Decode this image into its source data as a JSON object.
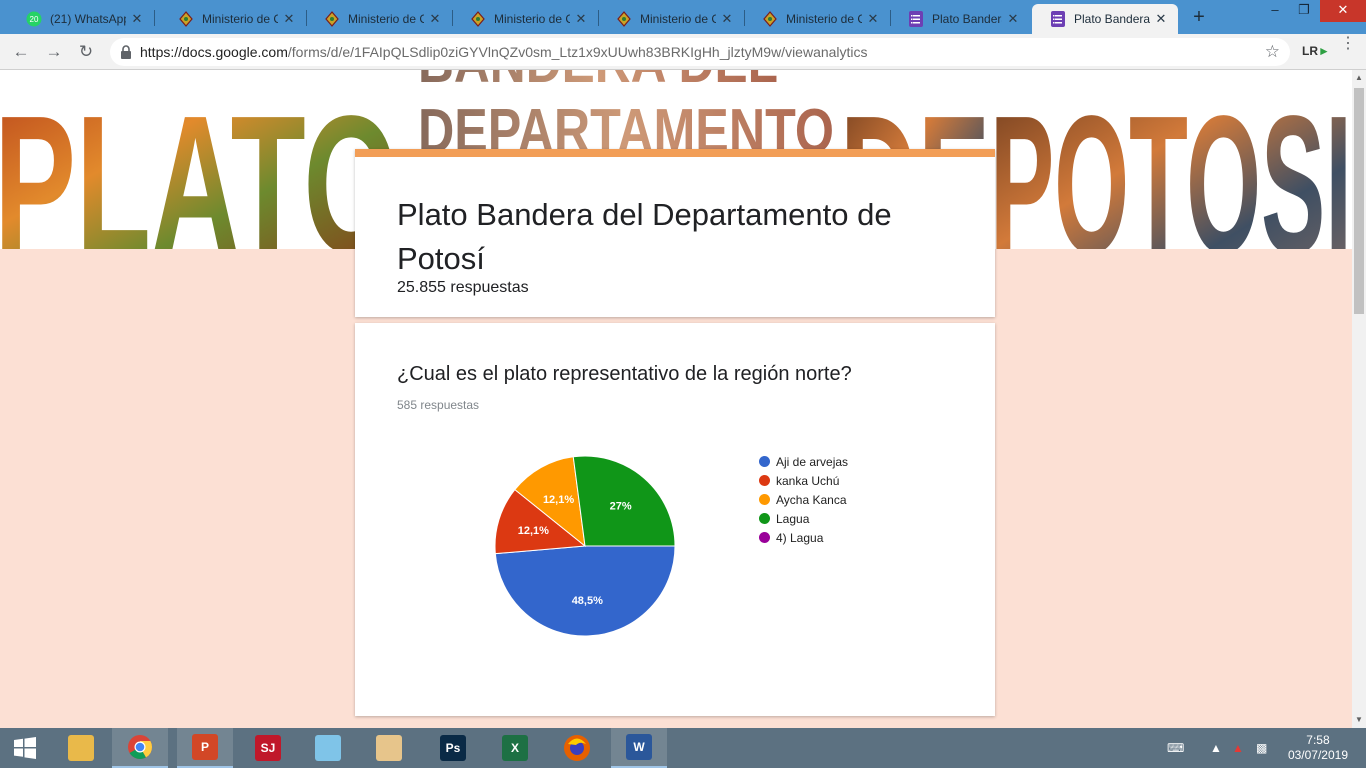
{
  "browser": {
    "tabs": [
      {
        "title": "(21) WhatsApp",
        "icon": "whatsapp-icon",
        "active": false
      },
      {
        "title": "Ministerio de C",
        "icon": "ministerio-icon",
        "active": false
      },
      {
        "title": "Ministerio de C",
        "icon": "ministerio-icon",
        "active": false
      },
      {
        "title": "Ministerio de C",
        "icon": "ministerio-icon",
        "active": false
      },
      {
        "title": "Ministerio de C",
        "icon": "ministerio-icon",
        "active": false
      },
      {
        "title": "Ministerio de C",
        "icon": "ministerio-icon",
        "active": false
      },
      {
        "title": "Plato Bandera d",
        "icon": "google-forms-icon",
        "active": false
      },
      {
        "title": "Plato Bandera d",
        "icon": "google-forms-icon",
        "active": true
      }
    ],
    "whatsapp_badge": "20",
    "url_host": "https://docs.google.com",
    "url_path": "/forms/d/e/1FAIpQLSdlip0ziGYVlnQZv0sm_Ltz1x9xUUwh83BRKIgHh_jlztyM9w/viewanalytics",
    "extension_label": "LR"
  },
  "banner": {
    "words": [
      "PLATO",
      "BANDERA DEL",
      "DEPARTAMENTO",
      "DE",
      "POTOSI"
    ]
  },
  "form": {
    "title": "Plato Bandera del Departamento de Potosí",
    "responses": "25.855 respuestas",
    "accent_color": "#f29e57",
    "background_color": "#fce0d4"
  },
  "question": {
    "title": "¿Cual es el plato representativo de la región norte?",
    "responses": "585 respuestas"
  },
  "chart_data": {
    "type": "pie",
    "labels": [
      "Aji de arvejas",
      "kanka Uchú",
      "Aycha Kanca",
      "Lagua",
      "4) Lagua"
    ],
    "values": [
      48.5,
      12.1,
      12.1,
      27,
      0
    ],
    "value_labels": [
      "48,5%",
      "12,1%",
      "12,1%",
      "27%",
      ""
    ],
    "colors": [
      "#3366cc",
      "#dc3912",
      "#ff9900",
      "#109618",
      "#990099"
    ],
    "start_angle_deg": 0,
    "legend": "right"
  },
  "taskbar": {
    "apps": [
      {
        "name": "file-explorer",
        "label": "",
        "color": "#e9b94a",
        "open": false
      },
      {
        "name": "chrome",
        "label": "",
        "color": "#ffffff",
        "open": true
      },
      {
        "name": "powerpoint",
        "label": "P",
        "color": "#d24726",
        "open": true
      },
      {
        "name": "sj-app",
        "label": "SJ",
        "color": "#c0182a",
        "open": false
      },
      {
        "name": "notes-app",
        "label": "",
        "color": "#7fc4e8",
        "open": false
      },
      {
        "name": "paint",
        "label": "",
        "color": "#e7c58b",
        "open": false
      },
      {
        "name": "photoshop",
        "label": "Ps",
        "color": "#0a2a46",
        "open": false
      },
      {
        "name": "excel",
        "label": "X",
        "color": "#1d7044",
        "open": false
      },
      {
        "name": "firefox",
        "label": "",
        "color": "#e66000",
        "open": false
      },
      {
        "name": "word",
        "label": "W",
        "color": "#2b579a",
        "open": true
      }
    ],
    "time": "7:58",
    "date": "03/07/2019"
  }
}
